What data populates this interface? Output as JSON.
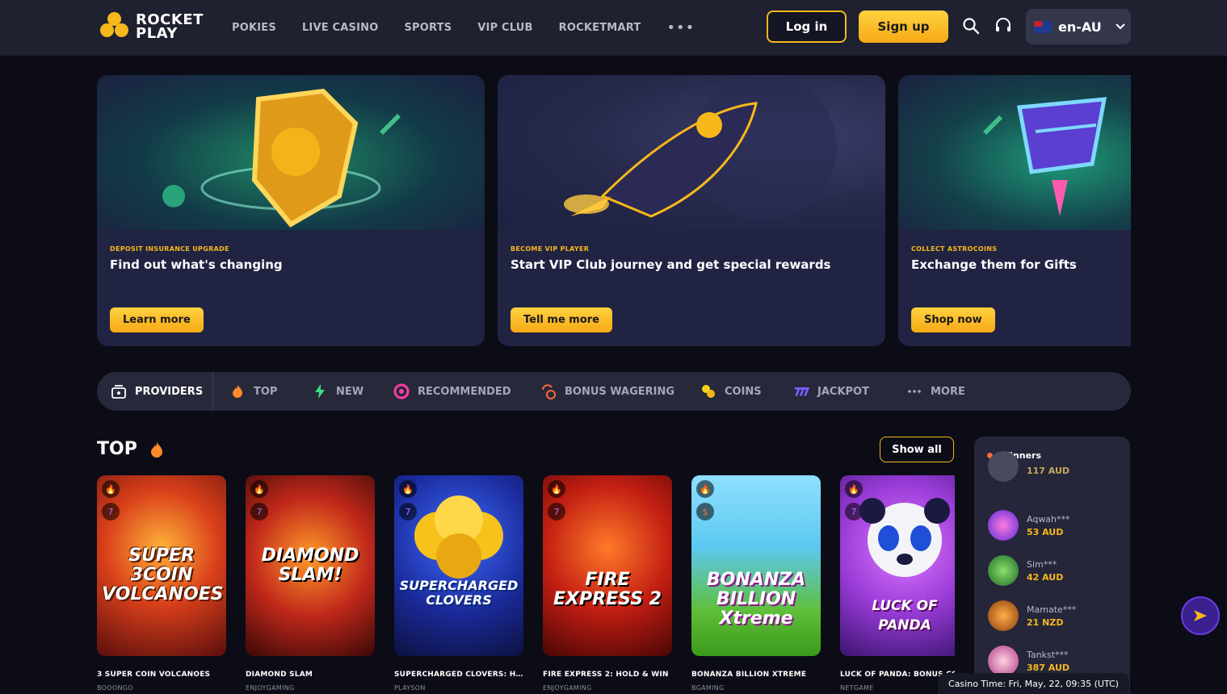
{
  "header": {
    "logo_line1": "ROCKET",
    "logo_line2": "PLAY",
    "nav": [
      "POKIES",
      "LIVE CASINO",
      "SPORTS",
      "VIP CLUB",
      "ROCKETMART"
    ],
    "nav_more": "•••",
    "login_label": "Log in",
    "signup_label": "Sign up",
    "language": "en-AU"
  },
  "promos": [
    {
      "kicker": "DEPOSIT INSURANCE UPGRADE",
      "title": "Find out what's changing",
      "button": "Learn more"
    },
    {
      "kicker": "BECOME VIP PLAYER",
      "title": "Start VIP Club journey and get special rewards",
      "button": "Tell me more"
    },
    {
      "kicker": "COLLECT ASTROCOINS",
      "title": "Exchange them for Gifts",
      "button": "Shop now"
    }
  ],
  "categories": [
    "PROVIDERS",
    "TOP",
    "NEW",
    "RECOMMENDED",
    "BONUS WAGERING",
    "COINS",
    "JACKPOT",
    "MORE"
  ],
  "section": {
    "title": "TOP",
    "show_all": "Show all"
  },
  "games": [
    {
      "art": "SUPER 3COIN VOLCANOES",
      "name": "3 SUPER COIN VOLCANOES",
      "provider": "BOOONGO"
    },
    {
      "art": "DIAMOND SLAM!",
      "name": "DIAMOND SLAM",
      "provider": "ENJOYGAMING"
    },
    {
      "art": "SUPERCHARGED CLOVERS",
      "name": "SUPERCHARGED CLOVERS: HO...",
      "provider": "PLAYSON"
    },
    {
      "art": "FIRE EXPRESS 2",
      "name": "FIRE EXPRESS 2: HOLD & WIN",
      "provider": "ENJOYGAMING"
    },
    {
      "art": "BONANZA BILLION Xtreme",
      "name": "BONANZA BILLION XTREME",
      "provider": "BGAMING"
    },
    {
      "art": "LUCK OF PANDA",
      "name": "LUCK OF PANDA: BONUS CO...",
      "provider": "NETGAME"
    }
  ],
  "winners": {
    "title": "Winners",
    "partial_amount": "117 AUD",
    "items": [
      {
        "name": "Aqwah***",
        "amount": "53 AUD"
      },
      {
        "name": "Sim***",
        "amount": "42 AUD"
      },
      {
        "name": "Mamate***",
        "amount": "21 NZD"
      },
      {
        "name": "Tankst***",
        "amount": "387 AUD"
      }
    ]
  },
  "casino_time": "Casino Time: Fri, May, 22, 09:35 (UTC)",
  "colors": {
    "accent": "#f6b81b",
    "header_bg": "#1f2030",
    "page_bg": "#0b0c16",
    "card_bg": "#212342"
  }
}
